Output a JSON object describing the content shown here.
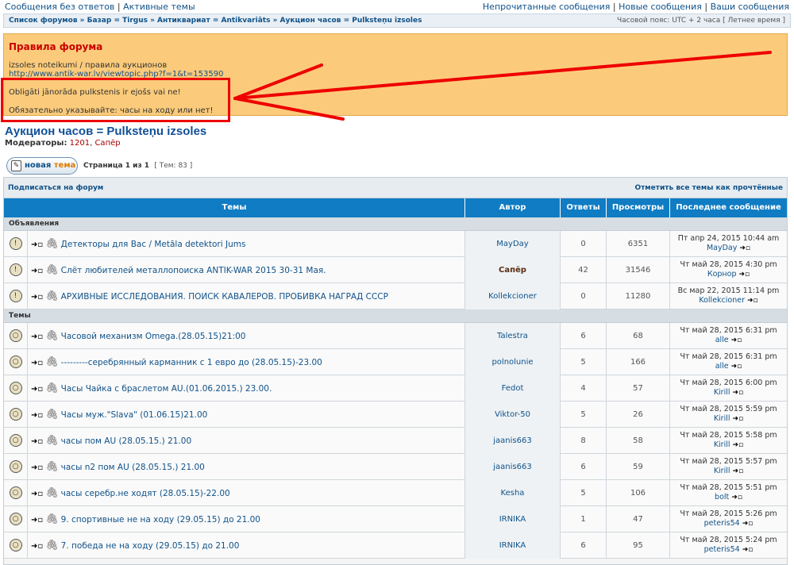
{
  "top": {
    "left_links": [
      "Сообщения без ответов",
      "Активные темы"
    ],
    "right_links": [
      "Непрочитанные сообщения",
      "Новые сообщения",
      "Ваши сообщения"
    ]
  },
  "nav": {
    "breadcrumb": "Список форумов » Базар = Tirgus » Антиквариат = Antikvariāts » Аукцион часов = Pulksteņu izsoles",
    "timezone": "Часовой пояс: UTC + 2 часа [ Летнее время ]"
  },
  "rules": {
    "title": "Правила форума",
    "line1": "izsoles noteikumi / правила аукционов",
    "link": "http://www.antik-war.lv/viewtopic.php?f=1&t=153590",
    "line3": "Obligāti jānorāda pulkstenis ir ejošs vai ne!",
    "line4": "Обязательно указывайте: часы на ходу или нет!"
  },
  "forum": {
    "title": "Аукцион часов = Pulksteņu izsoles",
    "moderators_label": "Модераторы:",
    "moderator1": "1201",
    "moderator2": "Сапёр",
    "new_topic_word1": "новая",
    "new_topic_word2": "тема",
    "pages": "Страница 1 из 1",
    "topics_count": "[ Тем: 83 ]"
  },
  "table": {
    "subscribe": "Подписаться на форум",
    "mark_read": "Отметить все темы как прочтённые",
    "headers": {
      "topics": "Темы",
      "author": "Автор",
      "replies": "Ответы",
      "views": "Просмотры",
      "last": "Последнее сообщение"
    },
    "section_announcements": "Объявления",
    "section_topics": "Темы",
    "announcements": [
      {
        "title": "Детекторы для Вас / Metāla detektori Jums",
        "author": "MayDay",
        "replies": "0",
        "views": "6351",
        "last_date": "Пт апр 24, 2015 10:44 am",
        "last_user": "MayDay"
      },
      {
        "title": "Слёт любителей металлопоиска ANTIK-WAR 2015 30-31 Мая.",
        "author": "Сапёр",
        "replies": "42",
        "views": "31546",
        "last_date": "Чт май 28, 2015 4:30 pm",
        "last_user": "Корнор"
      },
      {
        "title": "АРХИВНЫЕ ИССЛЕДОВАНИЯ. ПОИСК КАВАЛЕРОВ. ПРОБИВКА НАГРАД СССР",
        "author": "Kollekcioner",
        "replies": "0",
        "views": "11280",
        "last_date": "Вс мар 22, 2015 11:14 pm",
        "last_user": "Kollekcioner"
      }
    ],
    "topics": [
      {
        "title": "Часовой механизм Omega.(28.05.15)21:00",
        "author": "Talestra",
        "replies": "6",
        "views": "68",
        "last_date": "Чт май 28, 2015 6:31 pm",
        "last_user": "alle"
      },
      {
        "title": "---------серебрянный карманник с 1 евро до (28.05.15)-23.00",
        "author": "polnolunie",
        "replies": "5",
        "views": "166",
        "last_date": "Чт май 28, 2015 6:31 pm",
        "last_user": "alle"
      },
      {
        "title": "Часы Чайка с браслетом AU.(01.06.2015.) 23.00.",
        "author": "Fedot",
        "replies": "4",
        "views": "57",
        "last_date": "Чт май 28, 2015 6:00 pm",
        "last_user": "Kirill"
      },
      {
        "title": "Часы муж.\"Slava\" (01.06.15)21.00",
        "author": "Viktor-50",
        "replies": "5",
        "views": "26",
        "last_date": "Чт май 28, 2015 5:59 pm",
        "last_user": "Kirill"
      },
      {
        "title": "часы пом AU (28.05.15.) 21.00",
        "author": "jaanis663",
        "replies": "8",
        "views": "58",
        "last_date": "Чт май 28, 2015 5:58 pm",
        "last_user": "Kirill"
      },
      {
        "title": "часы n2 пом AU (28.05.15.) 21.00",
        "author": "jaanis663",
        "replies": "6",
        "views": "59",
        "last_date": "Чт май 28, 2015 5:57 pm",
        "last_user": "Kirill"
      },
      {
        "title": "часы серебр.не ходят (28.05.15)-22.00",
        "author": "Kesha",
        "replies": "5",
        "views": "106",
        "last_date": "Чт май 28, 2015 5:51 pm",
        "last_user": "bolt"
      },
      {
        "title": "9. спортивные не на ходу (29.05.15) до 21.00",
        "author": "IRNIKA",
        "replies": "1",
        "views": "47",
        "last_date": "Чт май 28, 2015 5:26 pm",
        "last_user": "peteris54"
      },
      {
        "title": "7. победа не на ходу (29.05.15) до 21.00",
        "author": "IRNIKA",
        "replies": "6",
        "views": "95",
        "last_date": "Чт май 28, 2015 5:24 pm",
        "last_user": "peteris54"
      }
    ]
  },
  "annotation_color": "#e00000",
  "accent_color": "#0f7cc4"
}
